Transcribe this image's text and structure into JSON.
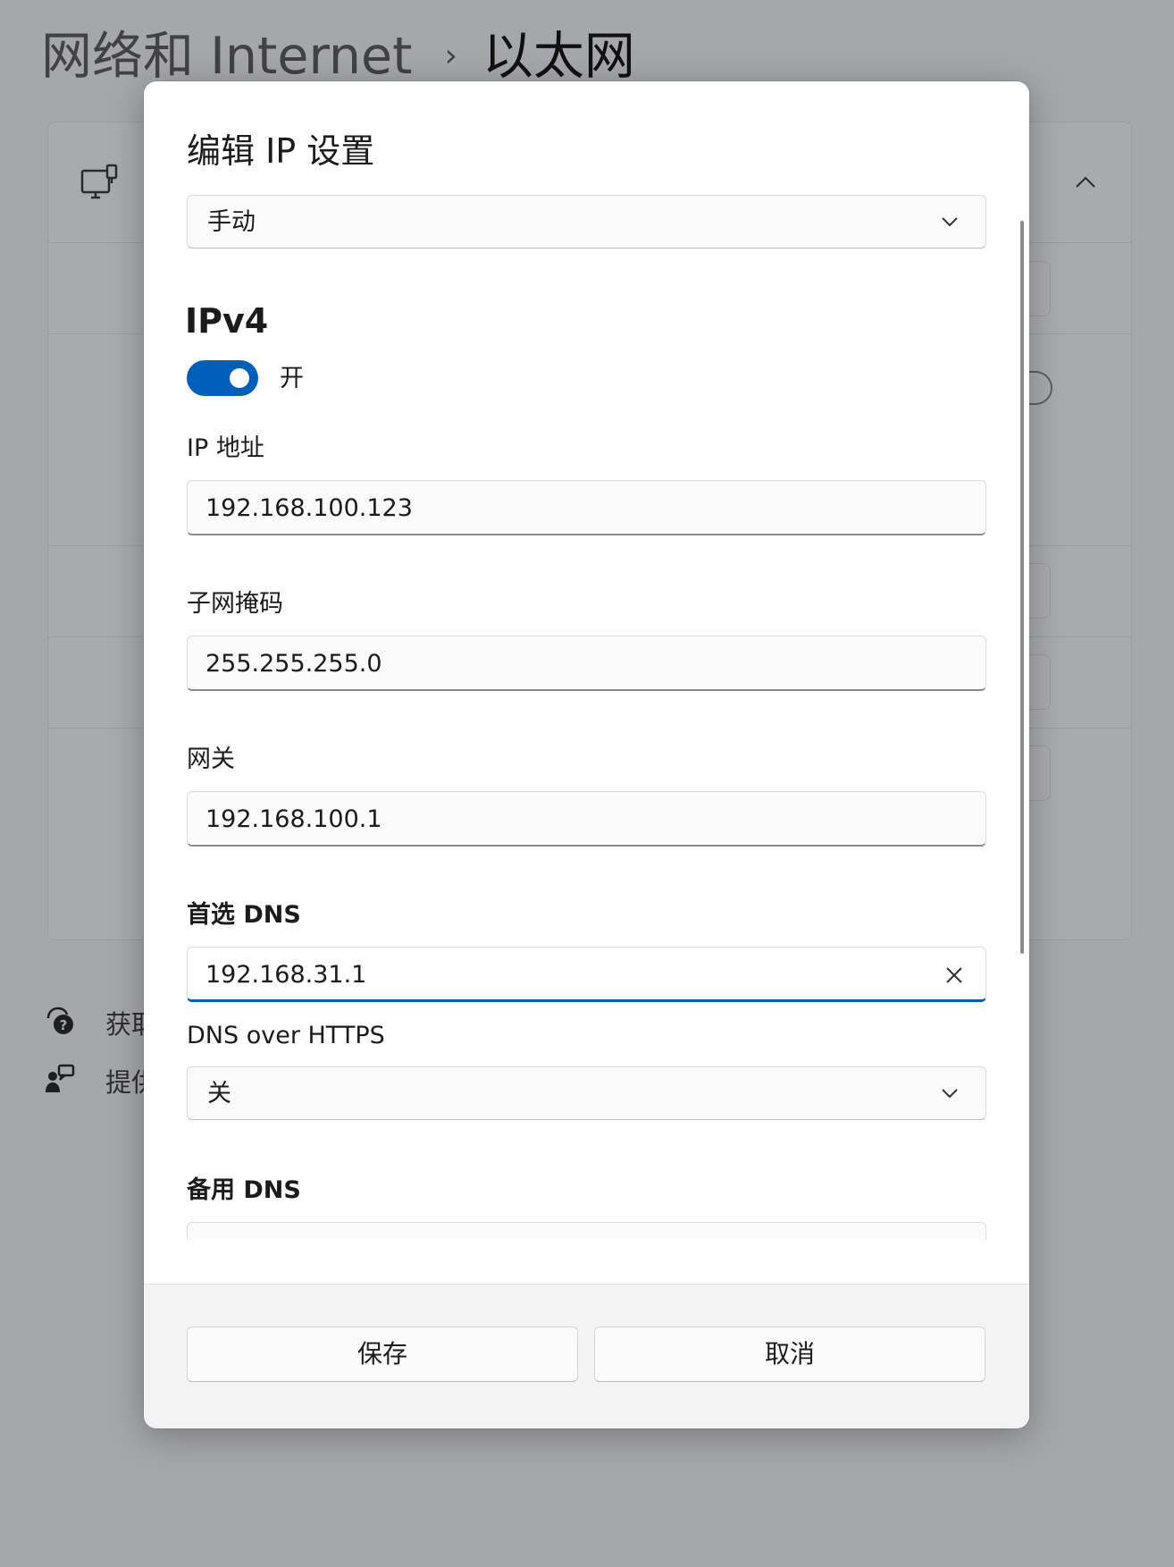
{
  "breadcrumb": {
    "parent": "网络和 Internet",
    "separator": "›",
    "current": "以太网"
  },
  "background_links": [
    {
      "label": "获取帮助",
      "icon": "help-chat-icon"
    },
    {
      "label": "提供反馈",
      "icon": "feedback-person-icon"
    }
  ],
  "dialog": {
    "title": "编辑 IP 设置",
    "mode_dropdown": {
      "value": "手动",
      "icon": "chevron-down-icon"
    },
    "ipv4": {
      "section_title": "IPv4",
      "toggle": {
        "state": "on",
        "label": "开"
      },
      "ip_address": {
        "label": "IP 地址",
        "value": "192.168.100.123"
      },
      "subnet_mask": {
        "label": "子网掩码",
        "value": "255.255.255.0"
      },
      "gateway": {
        "label": "网关",
        "value": "192.168.100.1"
      },
      "preferred_dns": {
        "label": "首选 DNS",
        "value": "192.168.31.1",
        "clear_icon": "close-icon"
      },
      "dns_over_https": {
        "label": "DNS over HTTPS",
        "value": "关"
      },
      "alternate_dns": {
        "label": "备用 DNS",
        "value": ""
      }
    },
    "footer": {
      "save_label": "保存",
      "cancel_label": "取消"
    }
  },
  "colors": {
    "accent": "#005fb8",
    "overlay": "#a6a7aa",
    "dialog_bg": "#ffffff",
    "footer_bg": "#f3f3f3"
  }
}
